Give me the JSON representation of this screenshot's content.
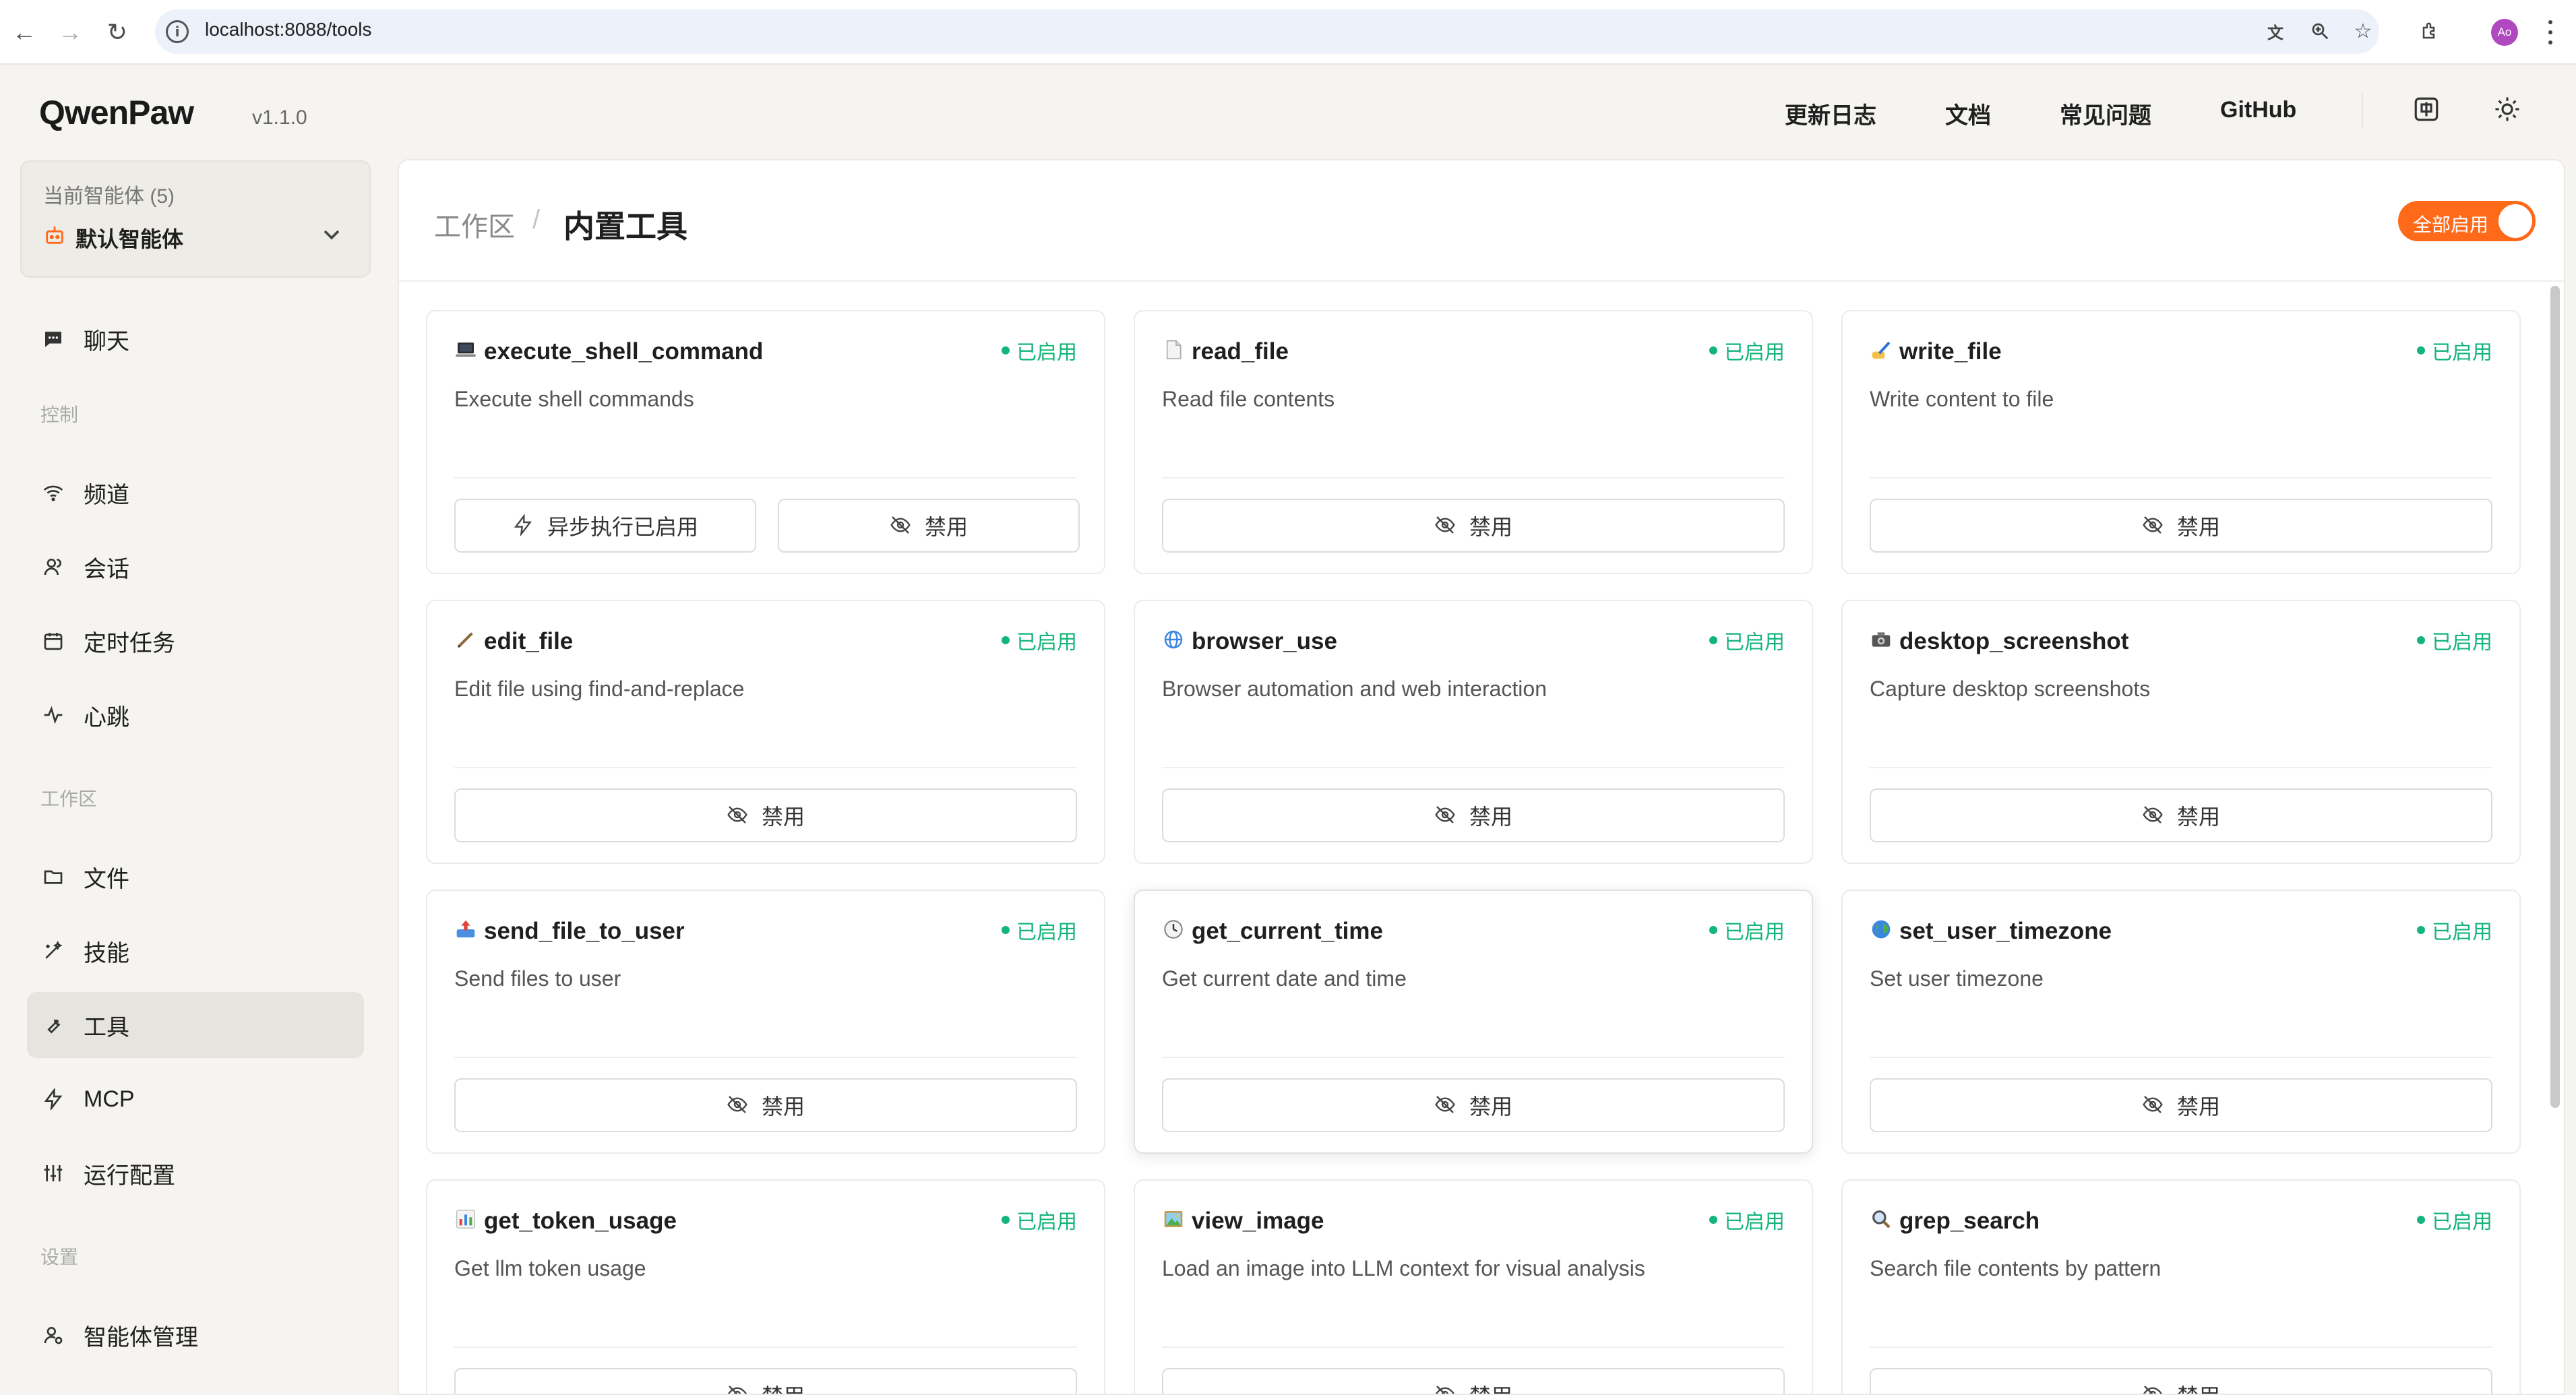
{
  "browser": {
    "url": "localhost:8088/tools",
    "avatar_initials": "Ao"
  },
  "app": {
    "logo": "QwenPaw",
    "version": "v1.1.0",
    "topnav": [
      "更新日志",
      "文档",
      "常见问题",
      "GitHub"
    ]
  },
  "agent": {
    "label": "当前智能体 (5)",
    "name": "默认智能体"
  },
  "sidebar": {
    "chat": "聊天",
    "section_control": "控制",
    "channel": "频道",
    "session": "会话",
    "cron": "定时任务",
    "heartbeat": "心跳",
    "section_workspace": "工作区",
    "files": "文件",
    "skills": "技能",
    "tools": "工具",
    "mcp": "MCP",
    "runtime": "运行配置",
    "section_settings": "设置",
    "agent_mgmt": "智能体管理"
  },
  "main": {
    "breadcrumb_root": "工作区",
    "breadcrumb_sep": "/",
    "title": "内置工具",
    "toggle_all_label": "全部启用",
    "toggle_all_on": true
  },
  "labels": {
    "enabled": "已启用",
    "disable": "禁用",
    "async_enabled": "异步执行已启用"
  },
  "colors": {
    "accent": "#ff6a1a",
    "status_green": "#14b47a"
  },
  "tools": [
    {
      "icon": "laptop-icon",
      "name": "execute_shell_command",
      "desc": "Execute shell commands"
    },
    {
      "icon": "page-icon",
      "name": "read_file",
      "desc": "Read file contents"
    },
    {
      "icon": "writing-hand-icon",
      "name": "write_file",
      "desc": "Write content to file"
    },
    {
      "icon": "pencil-icon",
      "name": "edit_file",
      "desc": "Edit file using find-and-replace"
    },
    {
      "icon": "globe-icon",
      "name": "browser_use",
      "desc": "Browser automation and web interaction"
    },
    {
      "icon": "camera-icon",
      "name": "desktop_screenshot",
      "desc": "Capture desktop screenshots"
    },
    {
      "icon": "outbox-icon",
      "name": "send_file_to_user",
      "desc": "Send files to user"
    },
    {
      "icon": "clock-icon",
      "name": "get_current_time",
      "desc": "Get current date and time"
    },
    {
      "icon": "earth-icon",
      "name": "set_user_timezone",
      "desc": "Set user timezone"
    },
    {
      "icon": "bar-chart-icon",
      "name": "get_token_usage",
      "desc": "Get llm token usage"
    },
    {
      "icon": "picture-icon",
      "name": "view_image",
      "desc": "Load an image into LLM context for visual analysis"
    },
    {
      "icon": "magnifier-icon",
      "name": "grep_search",
      "desc": "Search file contents by pattern"
    }
  ]
}
